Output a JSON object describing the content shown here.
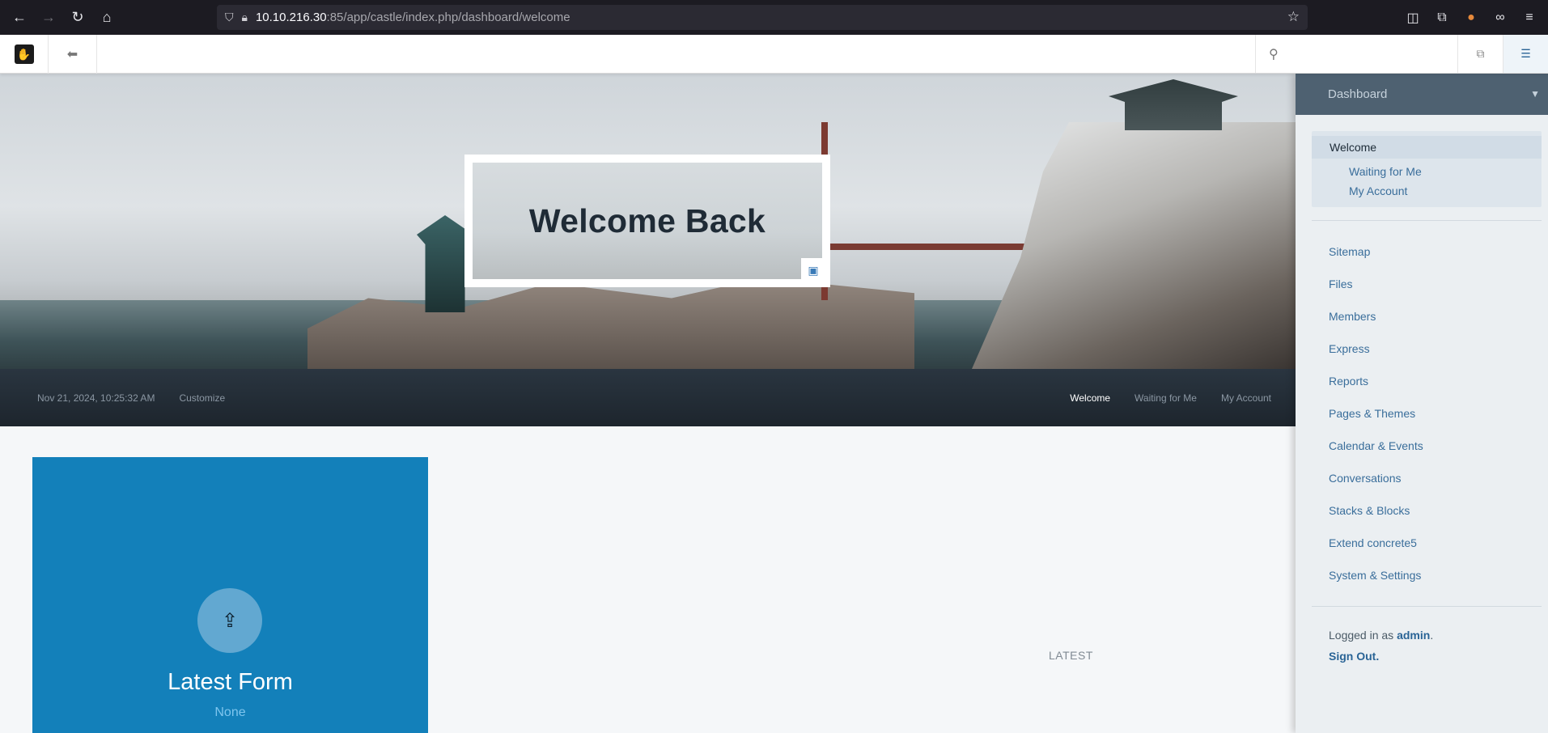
{
  "browser": {
    "url_host": "10.10.216.30",
    "url_rest": ":85/app/castle/index.php/dashboard/welcome"
  },
  "hero": {
    "title": "Welcome Back"
  },
  "dash_bar": {
    "date": "Nov 21, 2024, 10:25:32 AM",
    "customize": "Customize",
    "links": [
      "Welcome",
      "Waiting for Me",
      "My Account"
    ]
  },
  "tile": {
    "title": "Latest Form",
    "subtitle": "None"
  },
  "main": {
    "latest_label": "LATEST"
  },
  "panel": {
    "header": "Dashboard",
    "active_item": "Welcome",
    "sub_items": [
      "Waiting for Me",
      "My Account"
    ],
    "links": [
      "Sitemap",
      "Files",
      "Members",
      "Express",
      "Reports",
      "Pages & Themes",
      "Calendar & Events",
      "Conversations",
      "Stacks & Blocks",
      "Extend concrete5",
      "System & Settings"
    ],
    "logged_in_prefix": "Logged in as",
    "username": "admin",
    "sign_out": "Sign Out."
  },
  "colors": {
    "accent": "#1380ba",
    "panel_header": "#4e6171",
    "dark_bar": "#1d252d"
  }
}
